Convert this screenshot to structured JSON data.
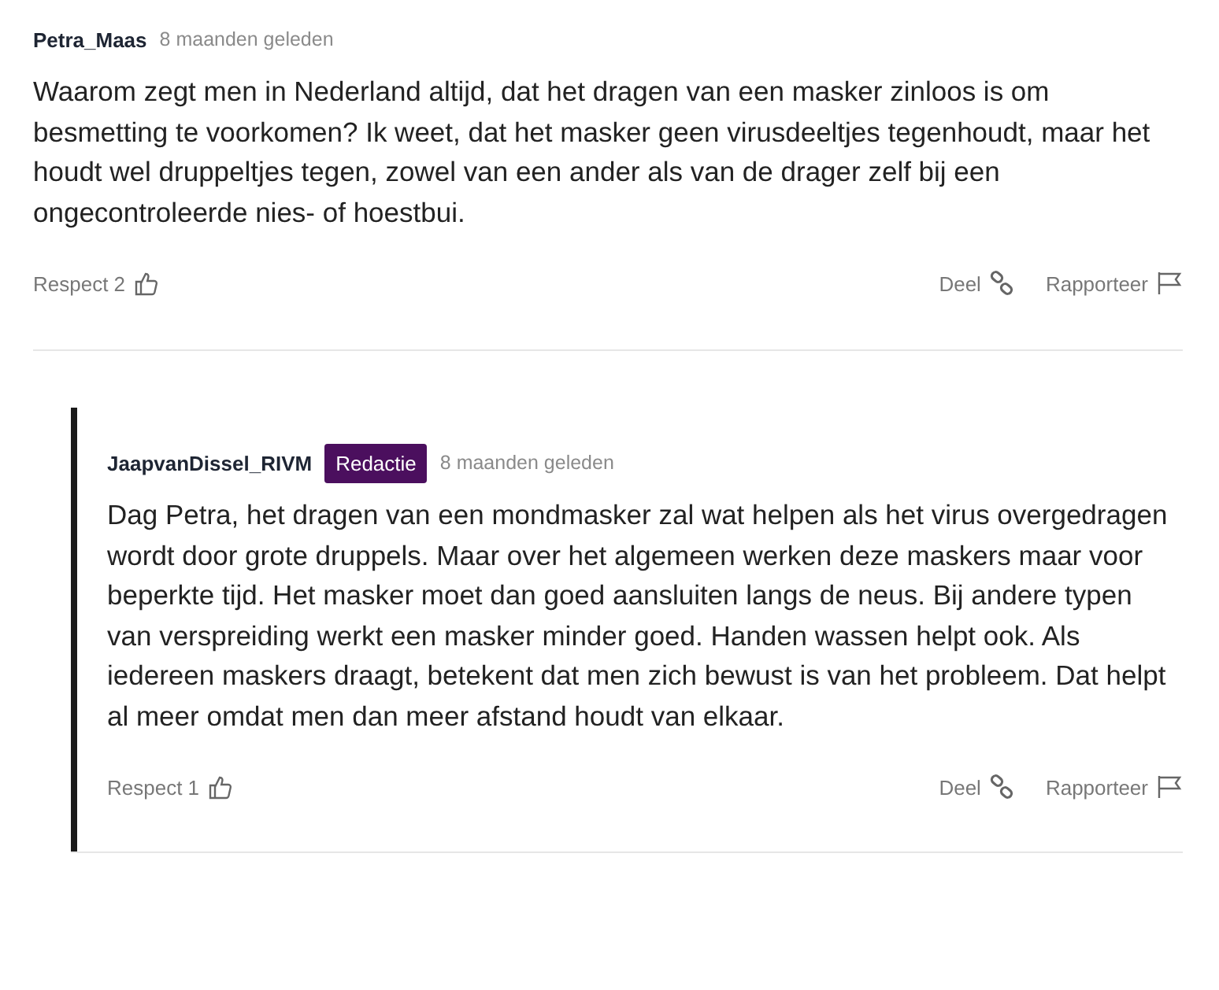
{
  "comments": [
    {
      "author": "Petra_Maas",
      "time": "8 maanden geleden",
      "body": "Waarom zegt men in Nederland altijd, dat het dragen van een masker zinloos is om besmetting te voorkomen? Ik weet, dat het masker geen virusdeeltjes tegenhoudt, maar het houdt wel druppeltjes tegen, zowel van een ander als van de drager zelf bij een ongecontroleerde nies- of hoestbui.",
      "respect": "Respect 2",
      "share": "Deel",
      "report": "Rapporteer",
      "replies": [
        {
          "author": "JaapvanDissel_RIVM",
          "badge": "Redactie",
          "time": "8 maanden geleden",
          "body": "Dag Petra, het dragen van een mondmasker zal wat helpen als het virus overgedragen wordt door grote druppels. Maar over het algemeen werken deze maskers maar voor beperkte tijd. Het masker moet dan goed aansluiten langs de neus. Bij andere typen van verspreiding werkt een masker minder goed. Handen wassen helpt ook. Als iedereen maskers draagt, betekent dat men zich bewust is van het probleem. Dat helpt al meer omdat men dan meer afstand houdt van elkaar.",
          "respect": "Respect 1",
          "share": "Deel",
          "report": "Rapporteer"
        }
      ]
    }
  ]
}
